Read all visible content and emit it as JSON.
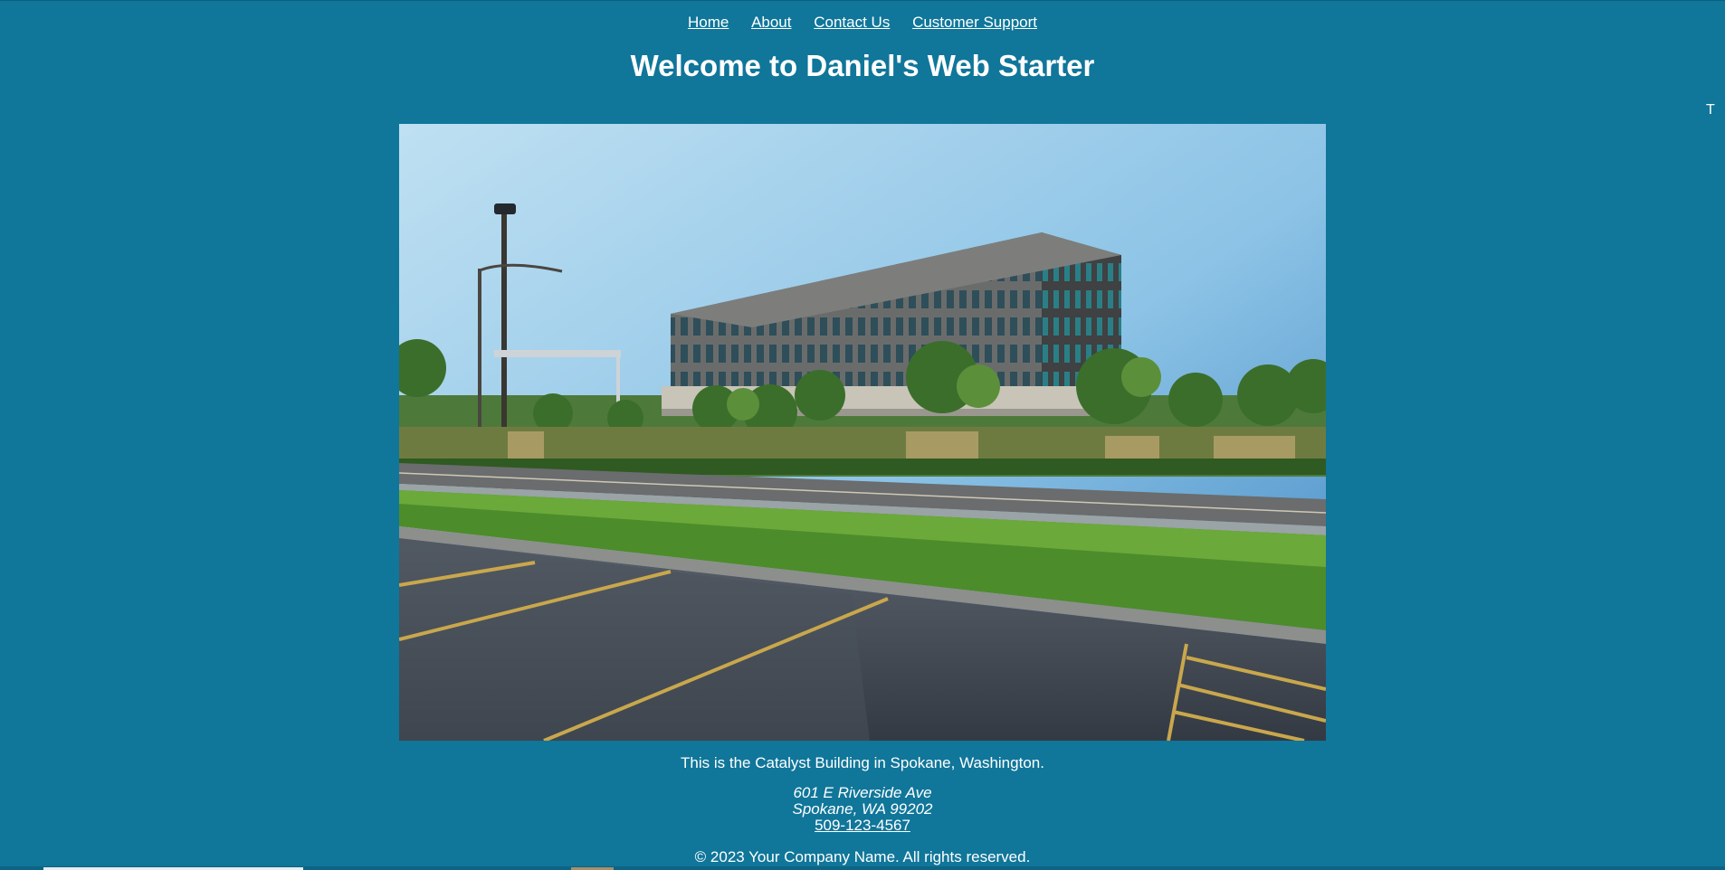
{
  "nav": {
    "items": [
      {
        "label": "Home"
      },
      {
        "label": "About"
      },
      {
        "label": "Contact Us"
      },
      {
        "label": "Customer Support"
      }
    ]
  },
  "header": {
    "title": "Welcome to Daniel's Web Starter"
  },
  "stray_char": "T",
  "hero": {
    "alt": "Catalyst Building in Spokane, Washington",
    "caption": "This is the Catalyst Building in Spokane, Washington."
  },
  "address": {
    "street": "601 E Riverside Ave",
    "city_line": "Spokane, WA 99202",
    "phone": "509-123-4567"
  },
  "footer": {
    "text": "© 2023 Your Company Name. All rights reserved."
  },
  "colors": {
    "background": "#10769a",
    "text": "#ffffff"
  }
}
